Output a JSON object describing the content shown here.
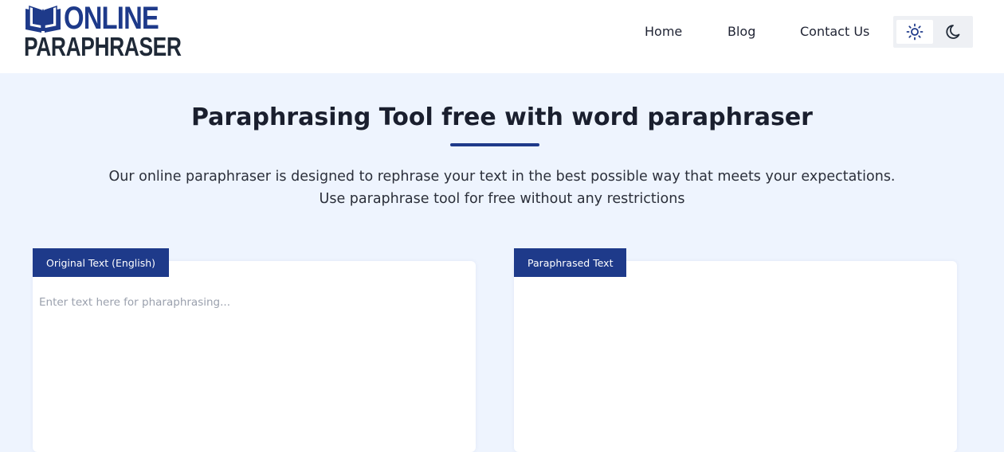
{
  "brand": {
    "line1": "ONLINE",
    "line2": "PARAPHRASER",
    "accent_color": "#1e3a8a"
  },
  "nav": {
    "items": [
      {
        "label": "Home"
      },
      {
        "label": "Blog"
      },
      {
        "label": "Contact Us"
      }
    ]
  },
  "theme_toggle": {
    "light_icon": "sun-icon",
    "dark_icon": "moon-icon",
    "active": "light"
  },
  "hero": {
    "title": "Paraphrasing Tool free with word paraphraser",
    "subtitle_line1": "Our online paraphraser is designed to rephrase your text in the best possible way that meets your expectations.",
    "subtitle_line2": "Use paraphrase tool for free without any restrictions"
  },
  "original_panel": {
    "tab_label": "Original Text (English)",
    "placeholder": "Enter text here for pharaphrasing...",
    "value": ""
  },
  "paraphrased_panel": {
    "tab_label": "Paraphrased Text",
    "value": ""
  },
  "colors": {
    "page_background": "#eef4fe",
    "tab_background": "#1e3a8a"
  }
}
